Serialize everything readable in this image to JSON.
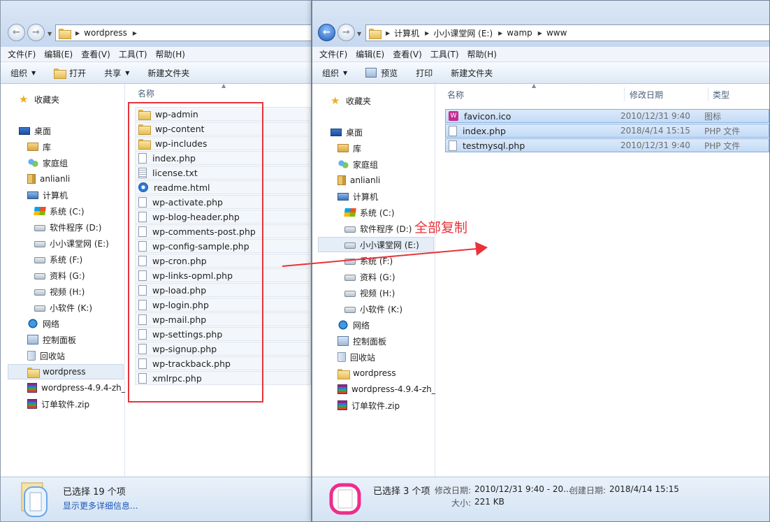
{
  "left_window": {
    "breadcrumb": [
      "wordpress"
    ],
    "menu": [
      "文件(F)",
      "编辑(E)",
      "查看(V)",
      "工具(T)",
      "帮助(H)"
    ],
    "toolbar": {
      "organize": "组织",
      "open": "打开",
      "share": "共享",
      "new_folder": "新建文件夹"
    },
    "column_name": "名称",
    "nav": {
      "favorites": "收藏夹",
      "desktop": "桌面",
      "libraries": "库",
      "homegroup": "家庭组",
      "user": "anlianli",
      "computer": "计算机",
      "drive_c": "系统 (C:)",
      "drive_d": "软件程序 (D:)",
      "drive_e": "小小课堂网 (E:)",
      "drive_f": "系统 (F:)",
      "drive_g": "资料 (G:)",
      "drive_h": "视频 (H:)",
      "drive_k": "小软件 (K:)",
      "network": "网络",
      "control_panel": "控制面板",
      "recycle_bin": "回收站",
      "wordpress": "wordpress",
      "wp_zip": "wordpress-4.9.4-zh_",
      "order_zip": "订单软件.zip"
    },
    "files": [
      "wp-admin",
      "wp-content",
      "wp-includes",
      "index.php",
      "license.txt",
      "readme.html",
      "wp-activate.php",
      "wp-blog-header.php",
      "wp-comments-post.php",
      "wp-config-sample.php",
      "wp-cron.php",
      "wp-links-opml.php",
      "wp-load.php",
      "wp-login.php",
      "wp-mail.php",
      "wp-settings.php",
      "wp-signup.php",
      "wp-trackback.php",
      "xmlrpc.php"
    ],
    "status": {
      "selected": "已选择 19 个项",
      "details_link": "显示更多详细信息..."
    }
  },
  "right_window": {
    "breadcrumb": [
      "计算机",
      "小小课堂网 (E:)",
      "wamp",
      "www"
    ],
    "menu": [
      "文件(F)",
      "编辑(E)",
      "查看(V)",
      "工具(T)",
      "帮助(H)"
    ],
    "toolbar": {
      "organize": "组织",
      "preview": "预览",
      "print": "打印",
      "new_folder": "新建文件夹"
    },
    "columns": {
      "name": "名称",
      "date": "修改日期",
      "type": "类型"
    },
    "nav": {
      "favorites": "收藏夹",
      "desktop": "桌面",
      "libraries": "库",
      "homegroup": "家庭组",
      "user": "anlianli",
      "computer": "计算机",
      "drive_c": "系统 (C:)",
      "drive_d": "软件程序 (D:)",
      "drive_e": "小小课堂网 (E:)",
      "drive_f": "系统 (F:)",
      "drive_g": "资料 (G:)",
      "drive_h": "视频 (H:)",
      "drive_k": "小软件 (K:)",
      "network": "网络",
      "control_panel": "控制面板",
      "recycle_bin": "回收站",
      "wordpress": "wordpress",
      "wp_zip": "wordpress-4.9.4-zh_",
      "order_zip": "订单软件.zip"
    },
    "files": [
      {
        "name": "favicon.ico",
        "date": "2010/12/31 9:40",
        "type": "图标"
      },
      {
        "name": "index.php",
        "date": "2018/4/14 15:15",
        "type": "PHP 文件"
      },
      {
        "name": "testmysql.php",
        "date": "2010/12/31 9:40",
        "type": "PHP 文件"
      }
    ],
    "status": {
      "selected": "已选择 3 个项",
      "modified_label": "修改日期:",
      "modified_value": "2010/12/31 9:40 - 20...",
      "created_label": "创建日期:",
      "created_value": "2018/4/14 15:15",
      "size_label": "大小:",
      "size_value": "221 KB"
    }
  },
  "annotation": {
    "text": "全部复制",
    "color": "#e8333a"
  },
  "icons": {
    "wamp_glyph": "W"
  }
}
